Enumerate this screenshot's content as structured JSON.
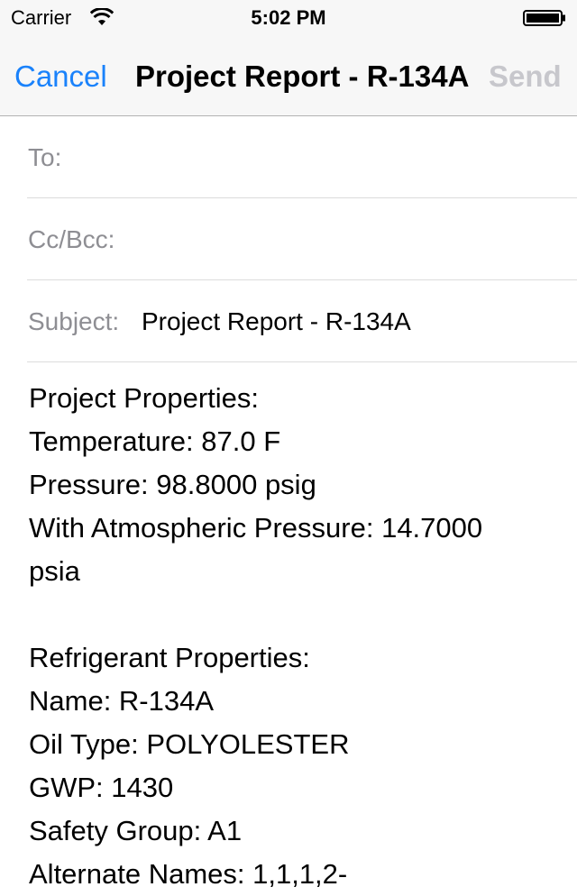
{
  "status_bar": {
    "carrier": "Carrier",
    "time": "5:02 PM"
  },
  "nav": {
    "cancel_label": "Cancel",
    "title": "Project Report - R-134A",
    "send_label": "Send"
  },
  "fields": {
    "to_label": "To:",
    "to_value": "",
    "cc_label": "Cc/Bcc:",
    "cc_value": "",
    "subject_label": "Subject:",
    "subject_value": "Project Report - R-134A"
  },
  "body": {
    "project_heading": "Project Properties:",
    "temperature": "Temperature: 87.0 F",
    "pressure": "Pressure: 98.8000 psig",
    "atm_pressure_1": "With Atmospheric Pressure: 14.7000",
    "atm_pressure_2": "psia",
    "refrigerant_heading": "Refrigerant Properties:",
    "name": "Name: R-134A",
    "oil_type": "Oil Type: POLYOLESTER",
    "gwp": "GWP: 1430",
    "safety_group": "Safety Group: A1",
    "alternate_names": "Alternate Names: 1,1,1,2-"
  },
  "colors": {
    "accent": "#1a82fb",
    "disabled": "#c7c7cc",
    "label_gray": "#8e8e93"
  }
}
